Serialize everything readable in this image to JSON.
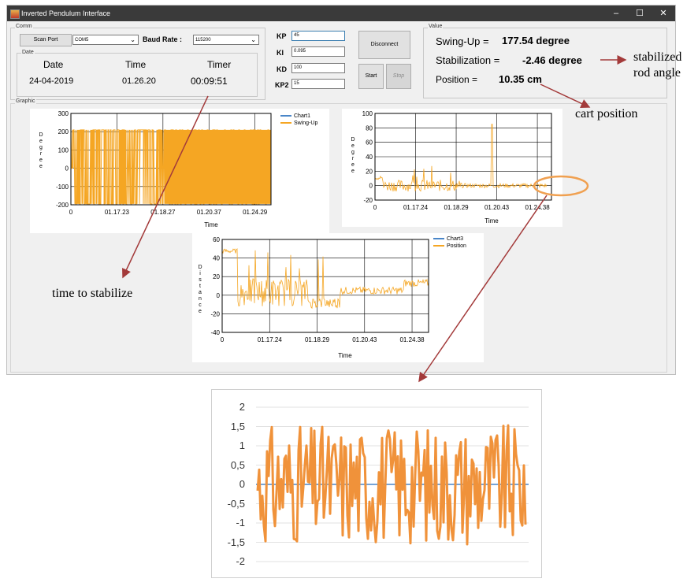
{
  "window": {
    "title": "Inverted Pendulum Interface",
    "minimize": "–",
    "maximize": "☐",
    "close": "✕"
  },
  "comm": {
    "group_label": "Comm",
    "scan_port_label": "Scan Port",
    "port_value": "COM5",
    "baud_label": "Baud Rate :",
    "baud_value": "115200"
  },
  "date_group": {
    "group_label": "Date",
    "date_header": "Date",
    "time_header": "Time",
    "timer_header": "Timer",
    "date_value": "24-04-2019",
    "time_value": "01.26.20",
    "timer_value": "00:09:51"
  },
  "gains": {
    "kp_label": "KP",
    "kp_value": "45",
    "ki_label": "KI",
    "ki_value": "0.095",
    "kd_label": "KD",
    "kd_value": "100",
    "kp2_label": "KP2",
    "kp2_value": "15"
  },
  "controls": {
    "disconnect_label": "Disconnect",
    "start_label": "Start",
    "stop_label": "Stop"
  },
  "value_group": {
    "group_label": "Value",
    "swing_label": "Swing-Up =",
    "swing_value": "177.54 degree",
    "stab_label": "Stabilization =",
    "stab_value": "-2.46 degree",
    "pos_label": "Position =",
    "pos_value": "10.35 cm"
  },
  "graphic": {
    "group_label": "Graphic"
  },
  "chart1": {
    "ylabel": "Degree",
    "xlabel": "Time",
    "yticks": [
      "300",
      "200",
      "100",
      "0",
      "-100",
      "-200"
    ],
    "xticks": [
      "0",
      "01.17.23",
      "01.18.27",
      "01.20.37",
      "01.24.29"
    ],
    "legend": [
      "Chart1",
      "Swing-Up"
    ]
  },
  "chart2": {
    "ylabel": "Degree",
    "xlabel": "Time",
    "yticks": [
      "100",
      "80",
      "60",
      "40",
      "20",
      "0",
      "-20"
    ],
    "xticks": [
      "0",
      "01.17.24",
      "01.18.29",
      "01.20.43",
      "01.24.38"
    ]
  },
  "chart3": {
    "ylabel": "Distance",
    "xlabel": "Time",
    "yticks": [
      "60",
      "40",
      "20",
      "0",
      "-20",
      "-40"
    ],
    "xticks": [
      "0",
      "01.17.24",
      "01.18.29",
      "01.20.43",
      "01.24.38"
    ],
    "legend": [
      "Chart3",
      "Position"
    ]
  },
  "zoom_chart": {
    "yticks": [
      "2",
      "1,5",
      "1",
      "0,5",
      "0",
      "-0,5",
      "-1",
      "-1,5",
      "-2"
    ]
  },
  "annotations": {
    "stabilized_1": "stabilized",
    "stabilized_2": "rod angle",
    "cart_position": "cart position",
    "time_to_stabilize": "time to stabilize"
  },
  "colors": {
    "series_orange": "#f5a623",
    "zoom_orange": "#f0923a",
    "legend_blue": "#4a86c8",
    "arrow_red": "#a33a3a",
    "ellipse_orange": "#f0a050"
  },
  "chart_data": [
    {
      "type": "line",
      "ylabel": "Degree",
      "xlabel": "Time",
      "ylim": [
        -200,
        300
      ],
      "series": [
        {
          "name": "Chart1",
          "values": []
        },
        {
          "name": "Swing-Up",
          "values": []
        }
      ]
    },
    {
      "type": "line",
      "ylabel": "Degree",
      "xlabel": "Time",
      "ylim": [
        -20,
        100
      ],
      "series": []
    },
    {
      "type": "line",
      "ylabel": "Distance",
      "xlabel": "Time",
      "ylim": [
        -40,
        60
      ],
      "series": [
        {
          "name": "Chart3",
          "values": []
        },
        {
          "name": "Position",
          "values": []
        }
      ]
    },
    {
      "type": "line",
      "ylim": [
        -2,
        2
      ],
      "series": []
    }
  ]
}
